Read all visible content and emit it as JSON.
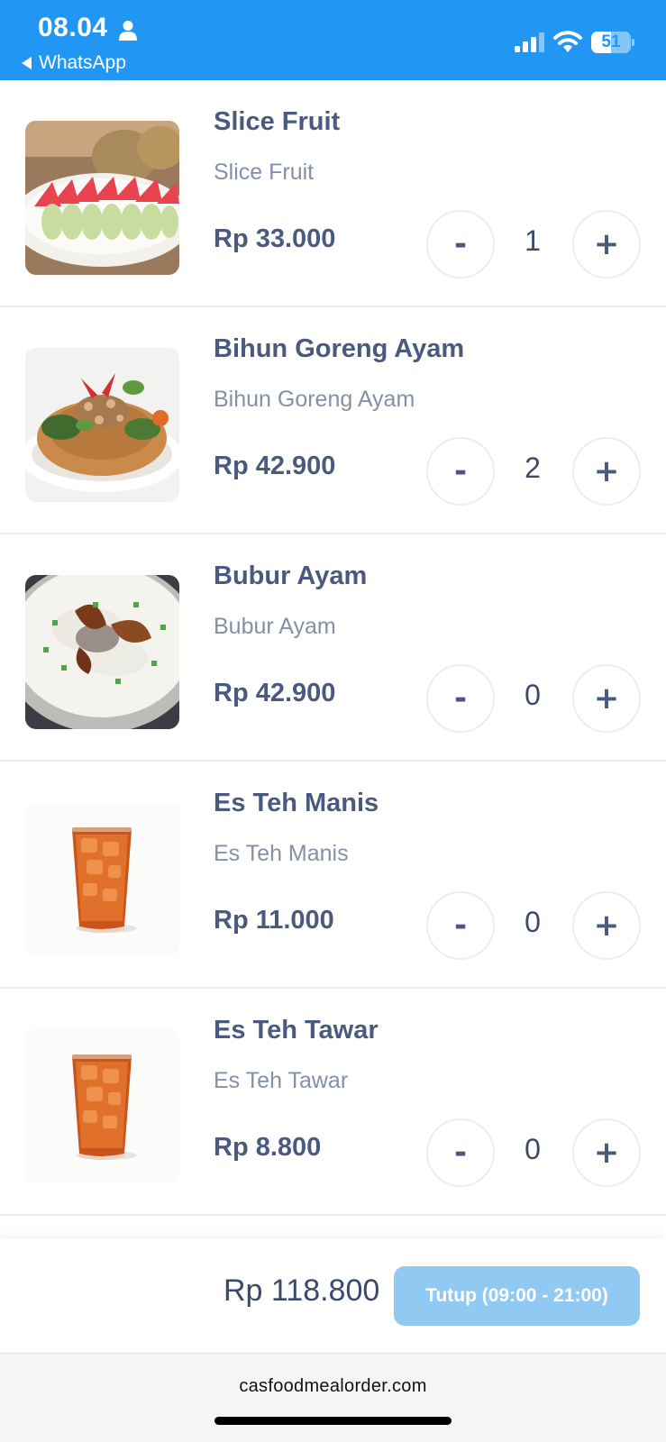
{
  "status_bar": {
    "time": "08.04",
    "back_label": "WhatsApp",
    "battery_level": "51",
    "battery_fraction": 0.51,
    "icons": [
      "person-icon",
      "signal-icon",
      "wifi-icon",
      "battery-icon"
    ]
  },
  "menu": {
    "items": [
      {
        "name": "Slice Fruit",
        "description": "Slice Fruit",
        "price": "Rp 33.000",
        "quantity": "1",
        "image_icon": "fruit-plate-image"
      },
      {
        "name": "Bihun Goreng Ayam",
        "description": "Bihun Goreng Ayam",
        "price": "Rp 42.900",
        "quantity": "2",
        "image_icon": "fried-noodles-image"
      },
      {
        "name": "Bubur Ayam",
        "description": "Bubur Ayam",
        "price": "Rp 42.900",
        "quantity": "0",
        "image_icon": "porridge-bowl-image"
      },
      {
        "name": "Es Teh Manis",
        "description": "Es Teh Manis",
        "price": "Rp 11.000",
        "quantity": "0",
        "image_icon": "iced-tea-image"
      },
      {
        "name": "Es Teh Tawar",
        "description": "Es Teh Tawar",
        "price": "Rp 8.800",
        "quantity": "0",
        "image_icon": "iced-tea-image"
      }
    ],
    "minus_label": "-",
    "plus_label": "+"
  },
  "cart": {
    "total": "Rp 118.800",
    "button_label": "Tutup (09:00 - 21:00)"
  },
  "browser": {
    "url": "casfoodmealorder.com"
  },
  "colors": {
    "header": "#2196f3",
    "button_disabled": "#90caf3",
    "text": "#4a5a7e"
  }
}
